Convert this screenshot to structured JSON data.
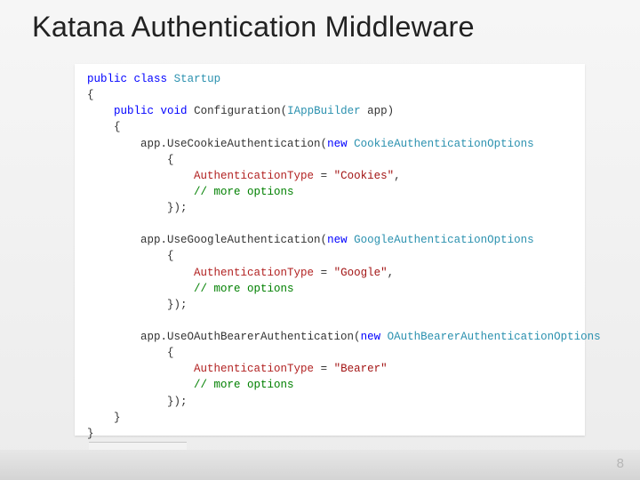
{
  "title": "Katana Authentication Middleware",
  "page_number": "8",
  "code": {
    "l1_kw1": "public",
    "l1_kw2": "class",
    "l1_type": "Startup",
    "l2": "{",
    "l3_kw1": "public",
    "l3_kw2": "void",
    "l3_name": "Configuration(",
    "l3_type": "IAppBuilder",
    "l3_rest": " app)",
    "l4": "{",
    "cookie_call1": "app.UseCookieAuthentication(",
    "cookie_kw": "new",
    "cookie_type": "CookieAuthenticationOptions",
    "brace_open": "{",
    "cookie_prop": "AuthenticationType",
    "eq": " = ",
    "cookie_val": "\"Cookies\"",
    "comma": ",",
    "more_comment": "// more options",
    "brace_close_stmt": "});",
    "google_call1": "app.UseGoogleAuthentication(",
    "google_kw": "new",
    "google_type": "GoogleAuthenticationOptions",
    "google_prop": "AuthenticationType",
    "google_val": "\"Google\"",
    "bearer_call1": "app.UseOAuthBearerAuthentication(",
    "bearer_kw": "new",
    "bearer_type": "OAuthBearerAuthenticationOptions",
    "bearer_prop": "AuthenticationType",
    "bearer_val": "\"Bearer\"",
    "close_method": "}",
    "close_class": "}"
  }
}
